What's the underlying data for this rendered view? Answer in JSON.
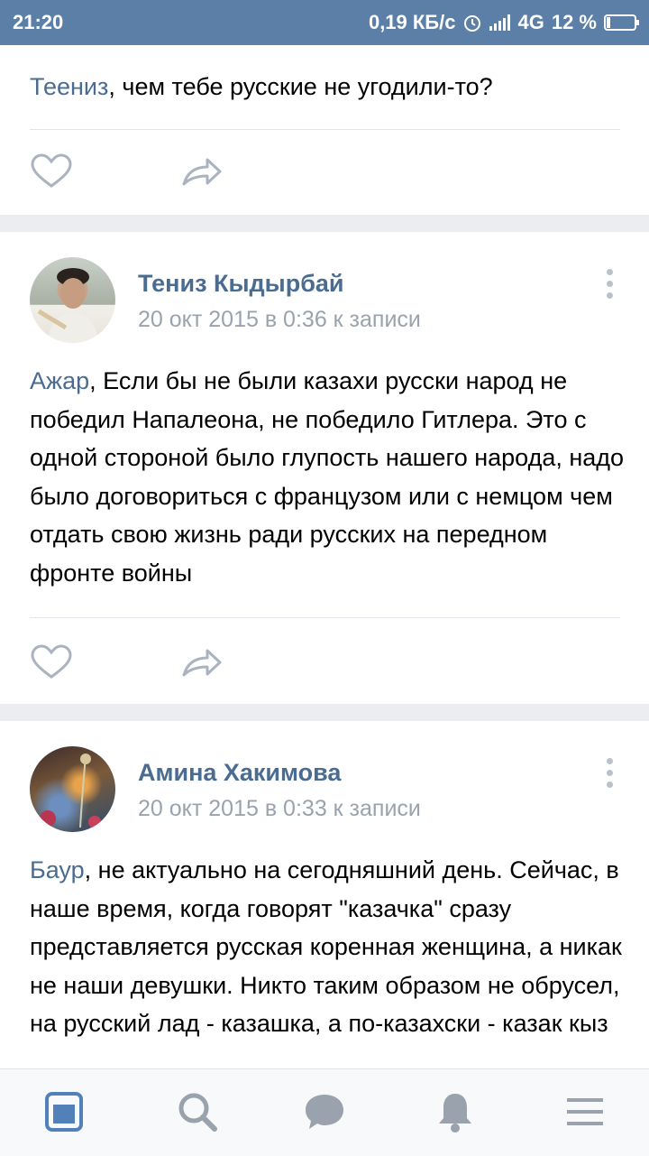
{
  "status_bar": {
    "time": "21:20",
    "net_speed": "0,19 КБ/с",
    "network": "4G",
    "battery": "12 %",
    "battery_level": 0.12,
    "icons": [
      "alarm-icon",
      "signal-icon",
      "battery-charging-icon"
    ]
  },
  "comments": [
    {
      "mention": "Теениз",
      "text": ", чем тебе русские не угодили-то?"
    },
    {
      "author": "Тениз Кыдырбай",
      "date": "20 окт 2015 в 0:36 к записи",
      "mention": "Ажар",
      "text": ", Если бы не были казахи русски народ не победил Напалеона, не победило Гитлера. Это с одной стороной было глупость нашего народа, надо было договориться с французом или с немцом чем отдать свою жизнь ради русских на передном фронте войны"
    },
    {
      "author": "Амина Хакимова",
      "date": "20 окт 2015 в 0:33 к записи",
      "mention": "Баур",
      "text": ", не актуально на сегодняшний день. Сейчас, в наше время, когда говорят \"казачка\" сразу представляется русская коренная женщина, а никак не наши девушки. Никто таким образом не обрусел, на русский лад - казашка, а по-казахски - казак кыз"
    }
  ],
  "tabbar": {
    "items": [
      "news-icon",
      "search-icon",
      "messages-icon",
      "notifications-icon",
      "menu-icon"
    ],
    "active": "news-icon",
    "active_color": "#5181b8",
    "inactive_color": "#99a2ad"
  }
}
